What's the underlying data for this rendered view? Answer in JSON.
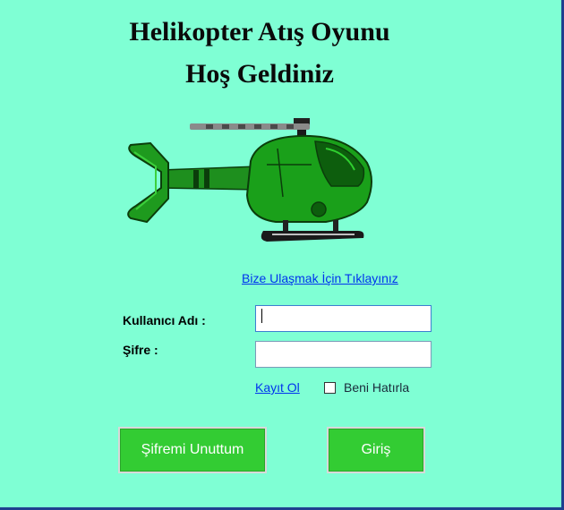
{
  "header": {
    "title_line1": "Helikopter Atış Oyunu",
    "title_line2": "Hoş Geldiniz"
  },
  "links": {
    "contact": "Bize Ulaşmak İçin Tıklayınız",
    "register": "Kayıt Ol"
  },
  "form": {
    "username_label": "Kullanıcı Adı :",
    "username_value": "",
    "password_label": "Şifre :",
    "password_value": "",
    "remember_label": "Beni Hatırla",
    "remember_checked": false
  },
  "buttons": {
    "forgot_password": "Şifremi Unuttum",
    "login": "Giriş"
  },
  "colors": {
    "background": "#7fffd4",
    "button": "#33cc33",
    "link": "#0033ee",
    "helicopter_body": "#1a9e1a"
  },
  "icons": {
    "helicopter": "helicopter-image"
  }
}
